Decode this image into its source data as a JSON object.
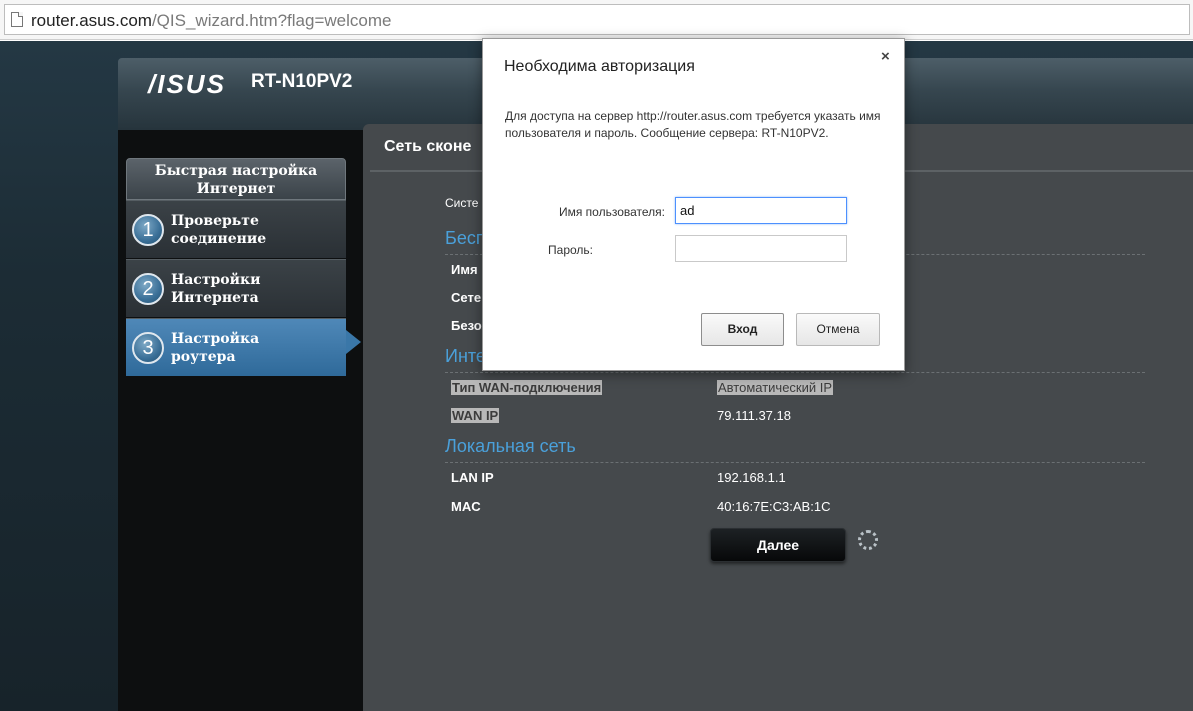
{
  "browser": {
    "url_host": "router.asus.com",
    "url_rest": "/QIS_wizard.htm?flag=welcome"
  },
  "router": {
    "brand": "/ISUS",
    "model": "RT-N10PV2"
  },
  "nav": {
    "header": "Быстрая настройка Интернет",
    "steps": [
      {
        "num": "1",
        "label": "Проверьте соединение"
      },
      {
        "num": "2",
        "label": "Настройки Интернета"
      },
      {
        "num": "3",
        "label": "Настройка роутера"
      }
    ]
  },
  "main": {
    "title": "Сеть сконе",
    "rows_partial": [
      "Систе",
      "Имя",
      "Сете",
      "Безо"
    ],
    "section_wireless": "Беспр",
    "section_internet": "Инте",
    "wan_type_label": "Тип WAN-подключения",
    "wan_type_value": "Автоматический IP",
    "wan_ip_label": "WAN IP",
    "wan_ip_value": "79.111.37.18",
    "section_lan": "Локальная сеть",
    "lan_ip_label": "LAN IP",
    "lan_ip_value": "192.168.1.1",
    "mac_label": "MAC",
    "mac_value": "40:16:7E:C3:AB:1C",
    "next_button": "Далее"
  },
  "dialog": {
    "title": "Необходима авторизация",
    "close": "×",
    "message": "Для доступа на сервер http://router.asus.com требуется указать имя пользователя и пароль. Сообщение сервера: RT-N10PV2.",
    "username_label": "Имя пользователя:",
    "username_value": "ad",
    "password_label": "Пароль:",
    "password_value": "",
    "login_button": "Вход",
    "cancel_button": "Отмена"
  },
  "colors": {
    "accent_blue": "#4aa0da",
    "active_step": "#3a77a8"
  }
}
